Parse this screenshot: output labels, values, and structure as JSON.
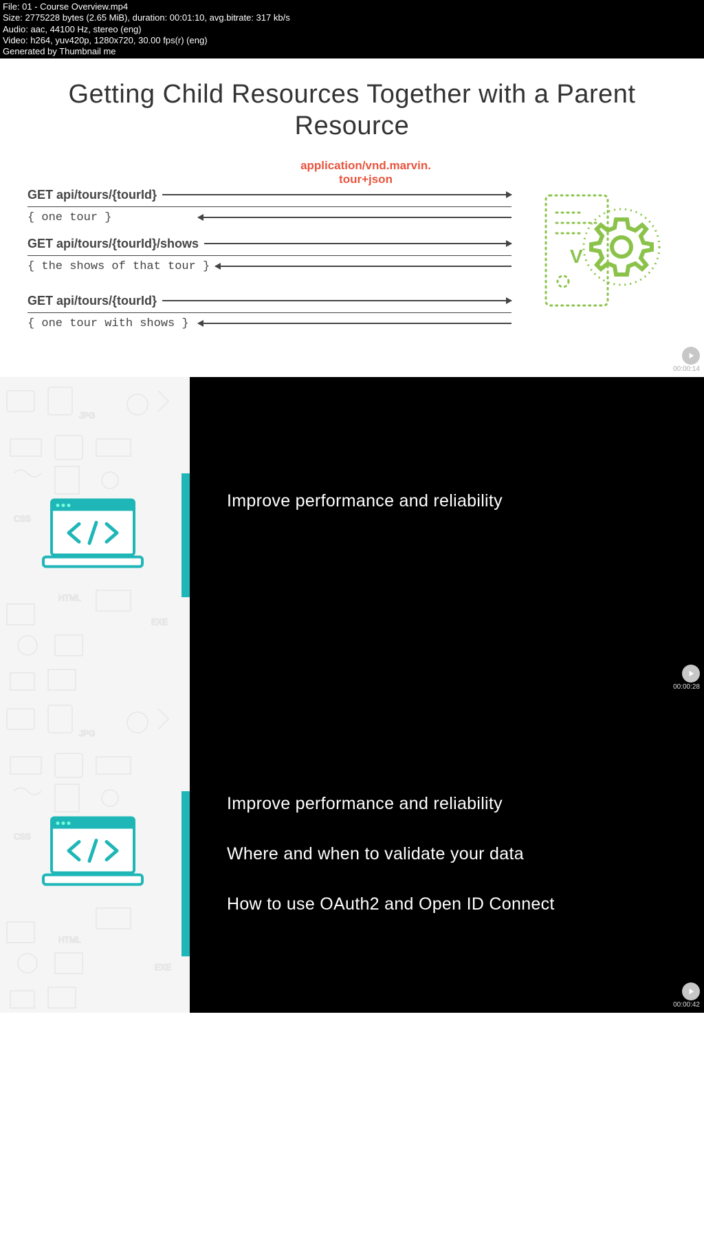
{
  "info": {
    "file": "File: 01 - Course Overview.mp4",
    "size": "Size: 2775228 bytes (2.65 MiB), duration: 00:01:10, avg.bitrate: 317 kb/s",
    "audio": "Audio: aac, 44100 Hz, stereo (eng)",
    "video": "Video: h264, yuv420p, 1280x720, 30.00 fps(r) (eng)",
    "gen": "Generated by Thumbnail me"
  },
  "frame1": {
    "title": "Getting Child Resources Together with a Parent Resource",
    "mime": "application/vnd.marvin.\ntour+json",
    "blocks": [
      {
        "req": "GET api/tours/{tourId}",
        "resp": "{ one tour }"
      },
      {
        "req": "GET api/tours/{tourId}/shows",
        "resp": "{ the shows of that tour }"
      },
      {
        "req": "GET api/tours/{tourId}",
        "resp": "{ one tour with shows }"
      }
    ],
    "ts": "00:00:14"
  },
  "frame2": {
    "lines": [
      "Improve performance and reliability"
    ],
    "ts": "00:00:28"
  },
  "frame3": {
    "lines": [
      "Improve performance and reliability",
      "Where and when to validate your data",
      "How to use OAuth2 and Open ID Connect"
    ],
    "ts": "00:00:42"
  }
}
